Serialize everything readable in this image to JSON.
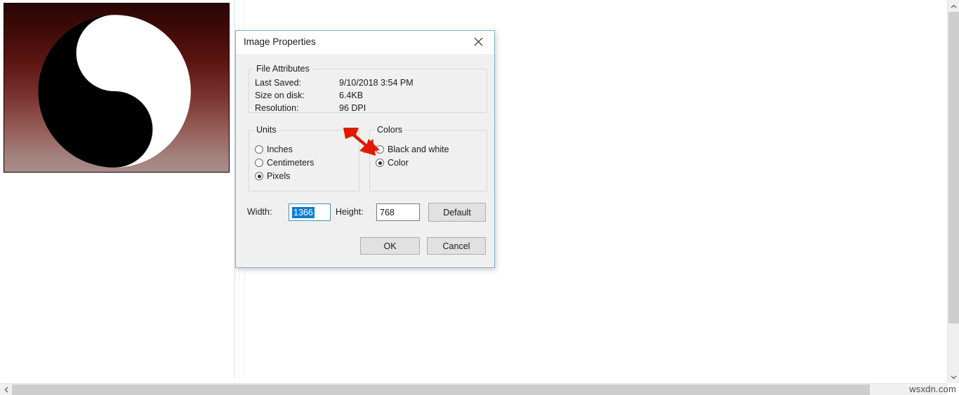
{
  "app": {
    "watermark": "wsxdn.com"
  },
  "canvas": {
    "image_name": "yin-yang-image",
    "background_gradient_top": "#2b0505",
    "background_gradient_bottom": "#a98b88"
  },
  "scrollbars": {
    "vertical_up": "⌃",
    "vertical_down": "⌄",
    "horizontal_left": "‹"
  },
  "dialog": {
    "title": "Image Properties",
    "close_label": "✕",
    "file_attributes": {
      "legend": "File Attributes",
      "rows": [
        {
          "label": "Last Saved:",
          "value": "9/10/2018 3:54 PM"
        },
        {
          "label": "Size on disk:",
          "value": "6.4KB"
        },
        {
          "label": "Resolution:",
          "value": "96 DPI"
        }
      ]
    },
    "units": {
      "legend": "Units",
      "options": [
        {
          "label": "Inches",
          "checked": false
        },
        {
          "label": "Centimeters",
          "checked": false
        },
        {
          "label": "Pixels",
          "checked": true
        }
      ]
    },
    "colors": {
      "legend": "Colors",
      "options": [
        {
          "label": "Black and white",
          "checked": false
        },
        {
          "label": "Color",
          "checked": true
        }
      ]
    },
    "dimensions": {
      "width_label": "Width:",
      "width_value": "1366",
      "width_selected": true,
      "height_label": "Height:",
      "height_value": "768"
    },
    "buttons": {
      "default": "Default",
      "ok": "OK",
      "cancel": "Cancel"
    },
    "accent_selection_color": "#0b7dd6",
    "border_color": "#7bb2c4"
  },
  "annotation": {
    "arrow_color": "#e01b00",
    "points_at": "Black and white"
  }
}
